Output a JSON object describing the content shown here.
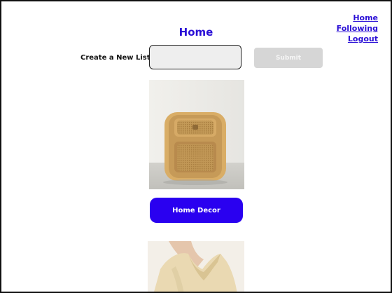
{
  "nav": {
    "home": "Home",
    "following": "Following",
    "logout": "Logout"
  },
  "page": {
    "title": "Home"
  },
  "create_list": {
    "label": "Create a New List",
    "input_value": "",
    "submit_label": "Submit"
  },
  "items": [
    {
      "category_label": "Home Decor",
      "image": "rattan-nightstand-photo"
    },
    {
      "image": "woman-cream-top-photo"
    }
  ],
  "colors": {
    "accent": "#2a0fd6",
    "button_primary": "#2a00f0",
    "submit_disabled": "#d6d6d6",
    "input_bg": "#eeeeee"
  }
}
